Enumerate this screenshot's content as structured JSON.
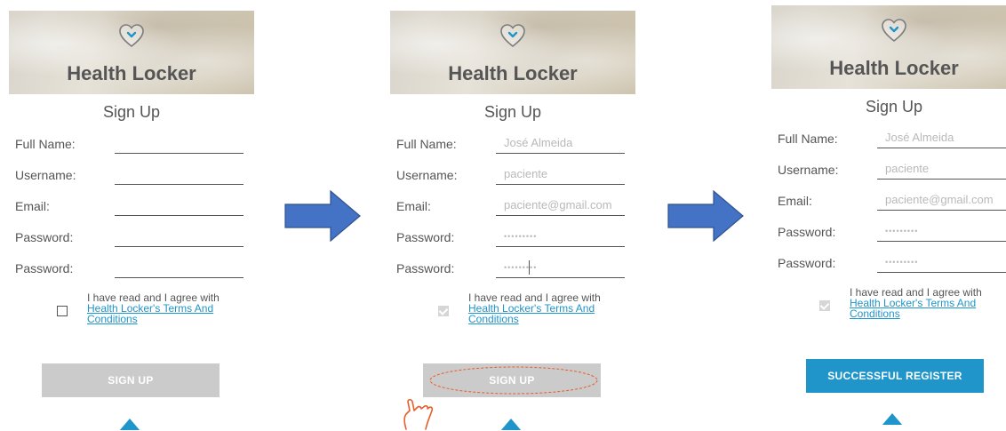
{
  "screens": [
    {
      "app_title": "Health Locker",
      "form_title": "Sign Up",
      "labels": [
        "Full Name:",
        "Username:",
        "Email:",
        "Password:",
        "Password:"
      ],
      "values": [
        "",
        "",
        "",
        "",
        ""
      ],
      "terms_text": "I have read and I agree with",
      "terms_link": "Health Locker's Terms And Conditions",
      "button": "SIGN UP",
      "checkbox_checked": false
    },
    {
      "app_title": "Health Locker",
      "form_title": "Sign Up",
      "labels": [
        "Full Name:",
        "Username:",
        "Email:",
        "Password:",
        "Password:"
      ],
      "values": [
        "José Almeida",
        "paciente",
        "paciente@gmail.com",
        "•••••••••",
        "•••••••••"
      ],
      "terms_text": "I have read and I agree with",
      "terms_link": "Health Locker's Terms And Conditions",
      "button": "SIGN UP",
      "checkbox_checked": true
    },
    {
      "app_title": "Health Locker",
      "form_title": "Sign Up",
      "labels": [
        "Full Name:",
        "Username:",
        "Email:",
        "Password:",
        "Password:"
      ],
      "values": [
        "José Almeida",
        "paciente",
        "paciente@gmail.com",
        "•••••••••",
        "•••••••••"
      ],
      "terms_text": "I have read and I agree with",
      "terms_link": "Health Locker's Terms And Conditions",
      "button": "SUCCESSFUL REGISTER",
      "checkbox_checked": true
    }
  ],
  "colors": {
    "accent": "#1f95c9",
    "button_disabled": "#cbcbcb",
    "arrow": "#4472c4",
    "tap_highlight": "#e85d2a"
  }
}
